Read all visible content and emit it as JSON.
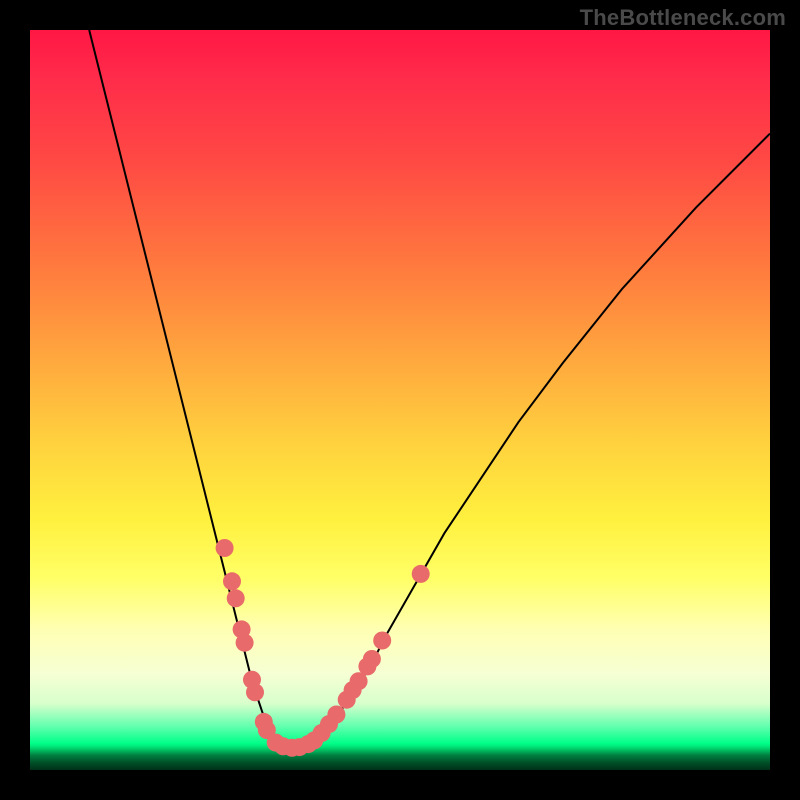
{
  "watermark": "TheBottleneck.com",
  "colors": {
    "dot": "#e96a6a",
    "curve": "#000000",
    "frame": "#000000"
  },
  "chart_data": {
    "type": "line",
    "title": "",
    "xlabel": "",
    "ylabel": "",
    "xlim": [
      0,
      100
    ],
    "ylim": [
      0,
      100
    ],
    "grid": false,
    "legend": false,
    "series": [
      {
        "name": "bottleneck-curve",
        "x": [
          8,
          10,
          12,
          14,
          16,
          18,
          20,
          22,
          24,
          26,
          27,
          28,
          29,
          30,
          31,
          32,
          33,
          34,
          35,
          36,
          37,
          38,
          40,
          42,
          44,
          46,
          48,
          52,
          56,
          60,
          66,
          72,
          80,
          90,
          100
        ],
        "y": [
          100,
          92,
          84,
          76,
          68,
          60,
          52,
          44,
          36,
          28,
          24,
          20,
          16,
          12,
          9,
          6,
          4.3,
          3.3,
          3,
          3,
          3.2,
          3.6,
          5.5,
          8,
          11,
          14,
          18,
          25,
          32,
          38,
          47,
          55,
          65,
          76,
          86
        ]
      }
    ],
    "markers": [
      {
        "x": 26.3,
        "y": 30.0
      },
      {
        "x": 27.3,
        "y": 25.5
      },
      {
        "x": 27.8,
        "y": 23.2
      },
      {
        "x": 28.6,
        "y": 19.0
      },
      {
        "x": 29.0,
        "y": 17.2
      },
      {
        "x": 30.0,
        "y": 12.2
      },
      {
        "x": 30.4,
        "y": 10.5
      },
      {
        "x": 31.6,
        "y": 6.5
      },
      {
        "x": 32.0,
        "y": 5.4
      },
      {
        "x": 33.2,
        "y": 3.7
      },
      {
        "x": 34.2,
        "y": 3.2
      },
      {
        "x": 35.4,
        "y": 3.0
      },
      {
        "x": 36.4,
        "y": 3.1
      },
      {
        "x": 37.6,
        "y": 3.5
      },
      {
        "x": 38.4,
        "y": 4.0
      },
      {
        "x": 39.4,
        "y": 5.0
      },
      {
        "x": 40.4,
        "y": 6.2
      },
      {
        "x": 41.4,
        "y": 7.5
      },
      {
        "x": 42.8,
        "y": 9.5
      },
      {
        "x": 43.6,
        "y": 10.8
      },
      {
        "x": 44.4,
        "y": 12.0
      },
      {
        "x": 45.6,
        "y": 14.0
      },
      {
        "x": 46.2,
        "y": 15.0
      },
      {
        "x": 47.6,
        "y": 17.5
      },
      {
        "x": 52.8,
        "y": 26.5
      }
    ],
    "marker_radius": 9
  }
}
